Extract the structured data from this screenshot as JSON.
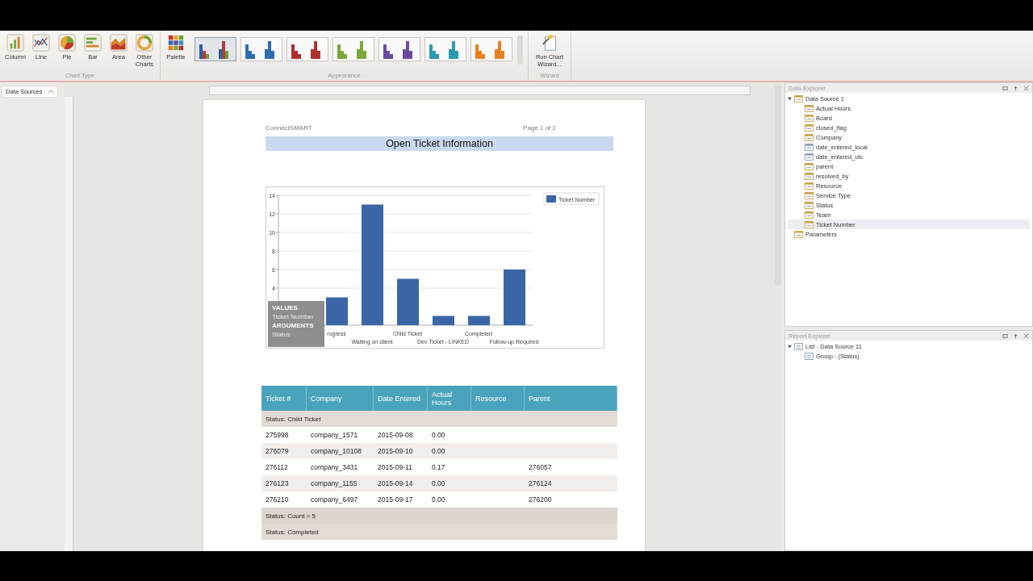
{
  "ribbon": {
    "chart_types": [
      {
        "label": "Column",
        "kind": "column"
      },
      {
        "label": "Line",
        "kind": "line"
      },
      {
        "label": "Pie",
        "kind": "pie"
      },
      {
        "label": "Bar",
        "kind": "bar"
      },
      {
        "label": "Area",
        "kind": "area"
      },
      {
        "label": "Other Charts",
        "kind": "other"
      }
    ],
    "chart_type_group": "Chart Type",
    "palette_button": "Palette",
    "palettes": [
      {
        "kind": "mixed",
        "color": "#2e5fa3",
        "selected": true
      },
      {
        "kind": "single",
        "color": "#2e6db4",
        "selected": false
      },
      {
        "kind": "single",
        "color": "#b03030",
        "selected": false
      },
      {
        "kind": "single",
        "color": "#7aa83a",
        "selected": false
      },
      {
        "kind": "single",
        "color": "#6a4a9e",
        "selected": false
      },
      {
        "kind": "single",
        "color": "#2a9ab0",
        "selected": false
      },
      {
        "kind": "single",
        "color": "#e8801e",
        "selected": false
      }
    ],
    "appearance_group": "Appearance",
    "wizard_button": "Run Chart Wizard...",
    "wizard_group": "Wizard"
  },
  "left_panel": {
    "title": "Data Sources"
  },
  "report": {
    "header_left": "ConnectSMART",
    "header_right": "Page 1 of 2",
    "title": "Open Ticket Information",
    "chart": {
      "chart_data": {
        "type": "bar",
        "categories": [
          "rogress",
          "Waiting on client",
          "Child Ticket",
          "Dev Ticket - LINKED",
          "Completed",
          "Follow-up Required"
        ],
        "series": [
          {
            "name": "Ticket Number",
            "color": "#3a66a8",
            "values": [
              3,
              13,
              5,
              1,
              1,
              6
            ]
          }
        ],
        "ylim": [
          0,
          14
        ],
        "yticks": [
          4,
          6,
          8,
          10,
          12,
          14
        ],
        "grid": true
      },
      "overlay": {
        "values_label": "VALUES",
        "values_field": "Ticket Number",
        "arguments_label": "ARGUMENTS",
        "arguments_field": "Status"
      }
    },
    "table": {
      "columns": [
        "Ticket #",
        "Company",
        "Date Entered",
        "Actual Hours",
        "Resource",
        "Parent"
      ],
      "rows": [
        {
          "kind": "group",
          "text": "Status: Child Ticket"
        },
        {
          "kind": "data",
          "cells": [
            "275998",
            "company_1571",
            "2015-09-08",
            "0.00",
            "",
            ""
          ]
        },
        {
          "kind": "data",
          "cells": [
            "276079",
            "company_10108",
            "2015-09-10",
            "0.00",
            "",
            ""
          ]
        },
        {
          "kind": "data",
          "cells": [
            "276112",
            "company_3431",
            "2015-09-11",
            "0.17",
            "",
            "276057"
          ]
        },
        {
          "kind": "data",
          "cells": [
            "276123",
            "company_1155",
            "2015-09-14",
            "0.00",
            "",
            "276124"
          ]
        },
        {
          "kind": "data",
          "cells": [
            "276210",
            "company_6497",
            "2015-09-17",
            "0.00",
            "",
            "276200"
          ]
        },
        {
          "kind": "footer",
          "text": "Status: Count = 5"
        },
        {
          "kind": "group",
          "text": "Status: Completed"
        }
      ]
    }
  },
  "data_explorer": {
    "title": "Data Explorer",
    "tree": [
      {
        "label": "Data Source 1",
        "kind": "source",
        "expanded": true,
        "selected": false,
        "children": [
          {
            "label": "Actual Hours",
            "kind": "number",
            "selected": false
          },
          {
            "label": "Board",
            "kind": "text",
            "selected": false
          },
          {
            "label": "closed_flag",
            "kind": "number",
            "selected": false
          },
          {
            "label": "Company",
            "kind": "text",
            "selected": false
          },
          {
            "label": "date_entered_local",
            "kind": "date",
            "selected": false
          },
          {
            "label": "date_entered_utc",
            "kind": "date",
            "selected": false
          },
          {
            "label": "parent",
            "kind": "text",
            "selected": false
          },
          {
            "label": "resolved_by",
            "kind": "text",
            "selected": false
          },
          {
            "label": "Resource",
            "kind": "text",
            "selected": false
          },
          {
            "label": "Service Type",
            "kind": "text",
            "selected": false
          },
          {
            "label": "Status",
            "kind": "text",
            "selected": false
          },
          {
            "label": "Team",
            "kind": "text",
            "selected": false
          },
          {
            "label": "Ticket Number",
            "kind": "number",
            "selected": true
          }
        ]
      },
      {
        "label": "Parameters",
        "kind": "params",
        "selected": false
      }
    ]
  },
  "report_explorer": {
    "title": "Report Explorer",
    "tree": [
      {
        "label": "List - Data Source 11",
        "kind": "list",
        "expanded": true,
        "selected": false,
        "children": [
          {
            "label": "Group - (Status)",
            "kind": "group",
            "selected": false
          }
        ]
      }
    ]
  }
}
